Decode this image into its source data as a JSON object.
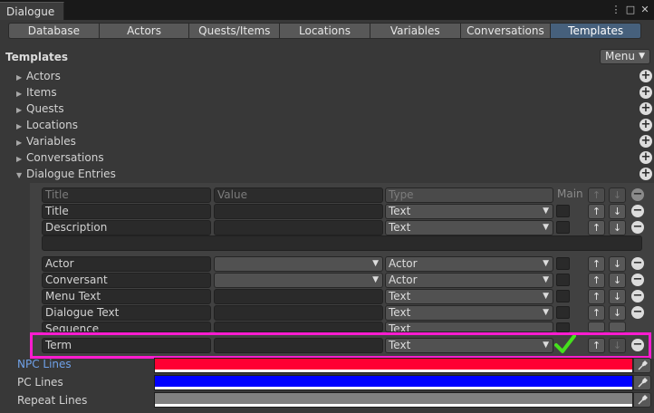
{
  "window": {
    "tab_title": "Dialogue"
  },
  "toolbar": {
    "tabs": [
      "Database",
      "Actors",
      "Quests/Items",
      "Locations",
      "Variables",
      "Conversations",
      "Templates"
    ],
    "active": "Templates"
  },
  "section": {
    "title": "Templates",
    "menu_label": "Menu"
  },
  "foldouts": [
    "Actors",
    "Items",
    "Quests",
    "Locations",
    "Variables",
    "Conversations",
    "Dialogue Entries"
  ],
  "fields_table": {
    "headers": {
      "title": "Title",
      "value": "Value",
      "type": "Type",
      "main": "Main"
    },
    "rows": [
      {
        "title": "Title",
        "value": "",
        "type": "Text"
      },
      {
        "title": "Description",
        "value": "",
        "type": "Text"
      },
      {
        "title": "Actor",
        "value": "",
        "type": "Actor"
      },
      {
        "title": "Conversant",
        "value": "",
        "type": "Actor"
      },
      {
        "title": "Menu Text",
        "value": "",
        "type": "Text"
      },
      {
        "title": "Dialogue Text",
        "value": "",
        "type": "Text"
      },
      {
        "title": "Sequence",
        "value": "",
        "type": "Text"
      },
      {
        "title": "Term",
        "value": "",
        "type": "Text",
        "main_checked": true
      }
    ]
  },
  "colors": [
    {
      "label": "NPC Lines",
      "color": "#ff0033"
    },
    {
      "label": "PC Lines",
      "color": "#0000ff"
    },
    {
      "label": "Repeat Lines",
      "color": "#808080"
    }
  ],
  "icons": {
    "add": "plus-icon",
    "remove": "minus-icon",
    "move_up": "arrow-up-icon",
    "move_down": "arrow-down-icon",
    "checkmark": "checkmark-icon",
    "eyedropper": "eyedropper-icon"
  },
  "accent": {
    "highlight": "#ff1cd0",
    "check": "#45e01c",
    "active_tab": "#46607c"
  }
}
